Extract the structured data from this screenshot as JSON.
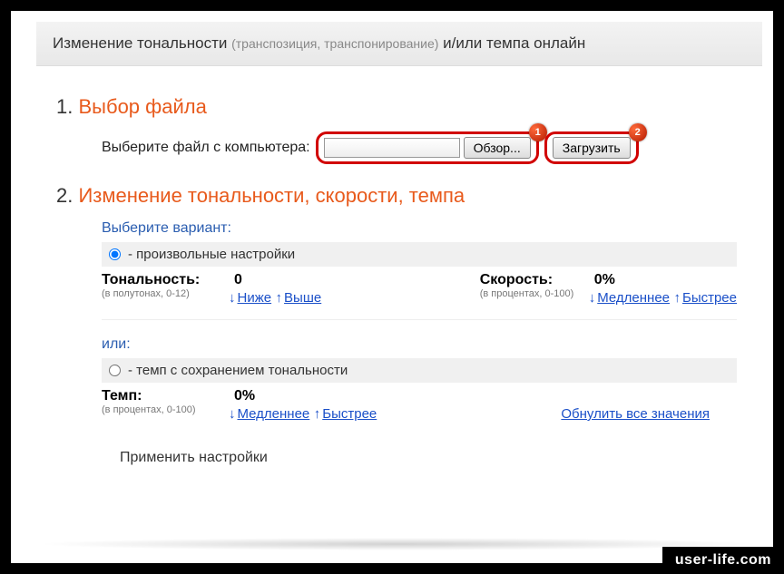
{
  "header": {
    "title_pre": "Изменение тональности",
    "title_paren": "(транспозиция, транспонирование)",
    "title_post": "и/или темпа онлайн"
  },
  "step1": {
    "num": "1.",
    "title": "Выбор файла",
    "label": "Выберите файл с компьютера:",
    "browse": "Обзор...",
    "upload": "Загрузить",
    "badge1": "1",
    "badge2": "2"
  },
  "step2": {
    "num": "2.",
    "title": "Изменение тональности, скорости, темпа",
    "variant_label": "Выберите вариант:",
    "opt_custom": "- произвольные настройки",
    "opt_tempo": "- темп с сохранением тональности",
    "or": "или:"
  },
  "tone": {
    "name": "Тональность:",
    "value": "0",
    "hint": "(в полутонах, 0-12)",
    "lower": "Ниже",
    "higher": "Выше"
  },
  "speed": {
    "name": "Скорость:",
    "value": "0%",
    "hint": "(в процентах, 0-100)",
    "slower": "Медленнее",
    "faster": "Быстрее"
  },
  "tempo": {
    "name": "Темп:",
    "value": "0%",
    "hint": "(в процентах, 0-100)",
    "slower": "Медленнее",
    "faster": "Быстрее"
  },
  "reset": "Обнулить все значения",
  "apply": "Применить настройки",
  "watermark": "user-life.com"
}
